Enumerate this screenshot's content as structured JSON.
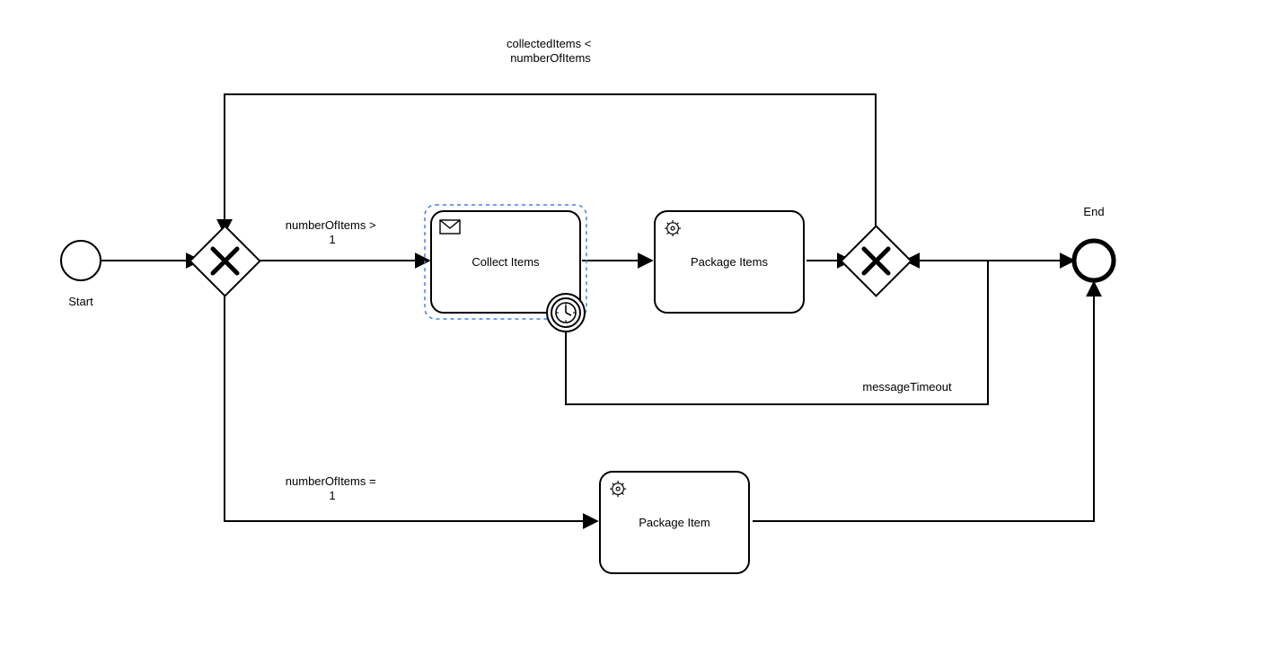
{
  "diagram": {
    "type": "BPMN process",
    "nodes": {
      "start": {
        "label": "Start"
      },
      "gateway1": {
        "label": ""
      },
      "collectItems": {
        "label": "Collect Items"
      },
      "packageItems": {
        "label": "Package Items"
      },
      "gateway2": {
        "label": ""
      },
      "packageItem": {
        "label": "Package Item"
      },
      "end": {
        "label": "End"
      }
    },
    "edges": {
      "startToG1": {
        "label": ""
      },
      "g1ToCollect": {
        "label": "numberOfItems >\n1"
      },
      "collectToPackageItems": {
        "label": ""
      },
      "packageItemsToG2": {
        "label": ""
      },
      "g2LoopBackToG1": {
        "label": "collectedItems <\nnumberOfItems"
      },
      "timerToG2": {
        "label": "messageTimeout"
      },
      "g2ToEnd": {
        "label": ""
      },
      "g1ToPackageItem": {
        "label": "numberOfItems =\n1"
      },
      "packageItemToEnd": {
        "label": ""
      }
    },
    "selected": "collectItems"
  }
}
